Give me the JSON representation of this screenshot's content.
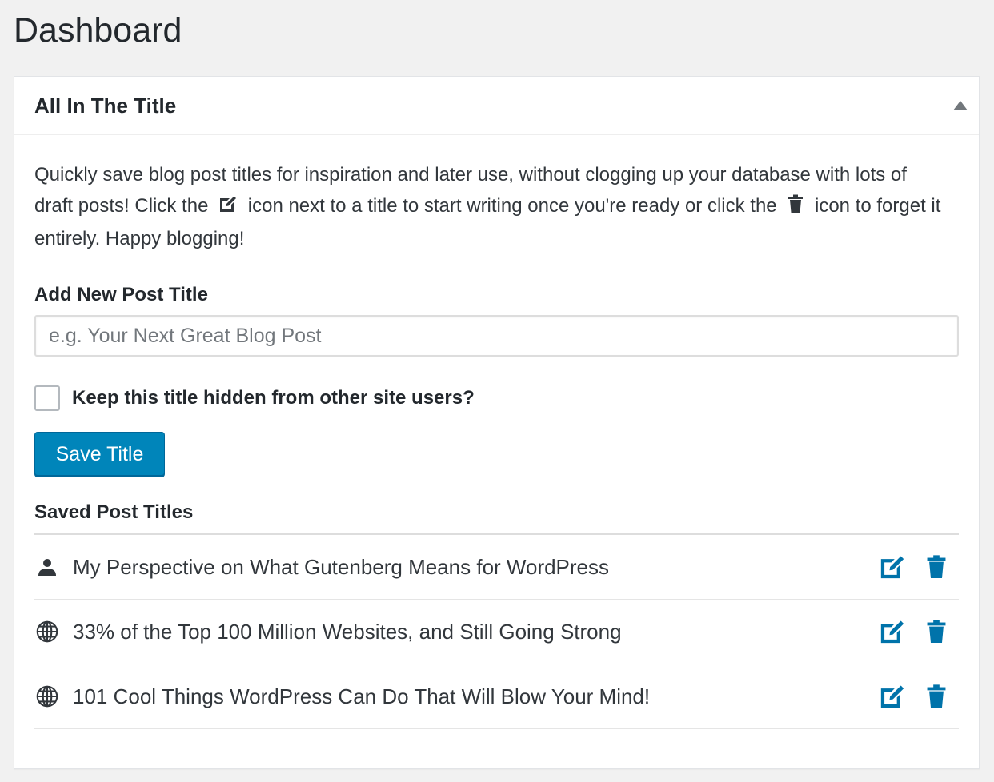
{
  "page": {
    "title": "Dashboard"
  },
  "widget": {
    "title": "All In The Title",
    "description_part1": "Quickly save blog post titles for inspiration and later use, without clogging up your database with lots of draft posts! Click the",
    "description_part2": "icon next to a title to start writing once you're ready or click the",
    "description_part3": "icon to forget it entirely. Happy blogging!",
    "add_label": "Add New Post Title",
    "input_placeholder": "e.g. Your Next Great Blog Post",
    "input_value": "",
    "hidden_label": "Keep this title hidden from other site users?",
    "hidden_checked": false,
    "save_label": "Save Title",
    "saved_heading": "Saved Post Titles",
    "saved_titles": [
      {
        "visibility_icon": "user-icon",
        "title": "My Perspective on What Gutenberg Means for WordPress"
      },
      {
        "visibility_icon": "globe-icon",
        "title": "33% of the Top 100 Million Websites, and Still Going Strong"
      },
      {
        "visibility_icon": "globe-icon",
        "title": "101 Cool Things WordPress Can Do That Will Blow Your Mind!"
      }
    ]
  },
  "colors": {
    "primary": "#0085ba",
    "action_icon": "#0073aa",
    "text": "#23282d",
    "background": "#f1f1f1"
  }
}
